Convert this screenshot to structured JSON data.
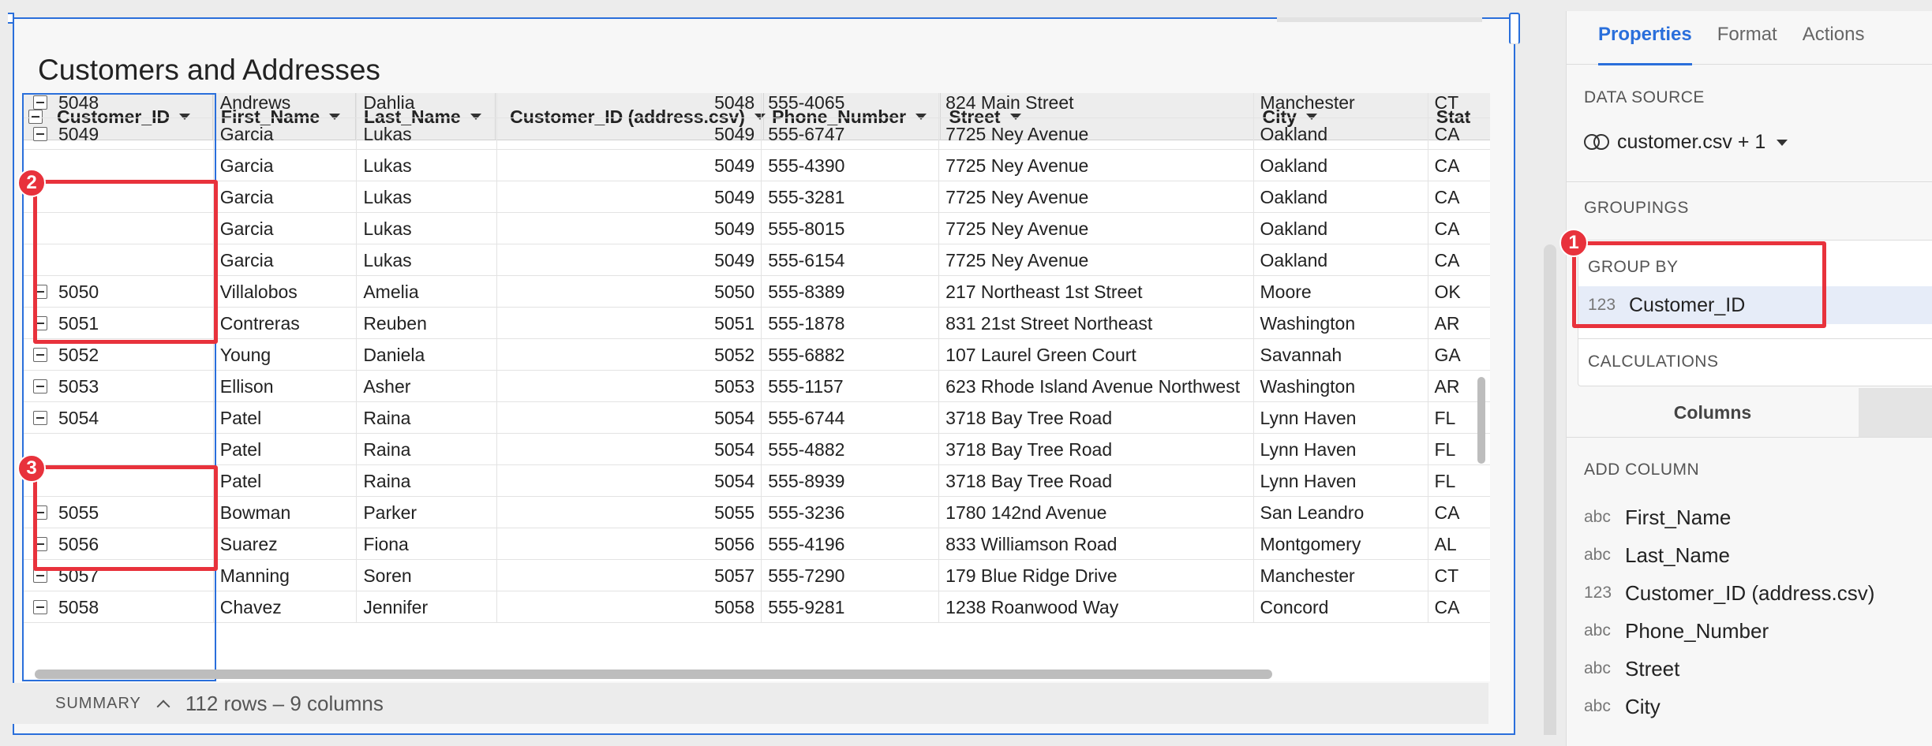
{
  "title": "Customers and Addresses",
  "table": {
    "columns": [
      "Customer_ID",
      "First_Name",
      "Last_Name",
      "Customer_ID (address.csv)",
      "Phone_Number",
      "Street",
      "City",
      "Stat"
    ],
    "rows": [
      {
        "id": "5048",
        "first": "Andrews",
        "last": "Dahlia",
        "cid": "5048",
        "phone": "555-4065",
        "street": "824 Main Street",
        "city": "Manchester",
        "state": "CT",
        "group": true
      },
      {
        "id": "5049",
        "first": "Garcia",
        "last": "Lukas",
        "cid": "5049",
        "phone": "555-6747",
        "street": "7725 Ney Avenue",
        "city": "Oakland",
        "state": "CA",
        "group": true
      },
      {
        "id": "",
        "first": "Garcia",
        "last": "Lukas",
        "cid": "5049",
        "phone": "555-4390",
        "street": "7725 Ney Avenue",
        "city": "Oakland",
        "state": "CA",
        "group": false
      },
      {
        "id": "",
        "first": "Garcia",
        "last": "Lukas",
        "cid": "5049",
        "phone": "555-3281",
        "street": "7725 Ney Avenue",
        "city": "Oakland",
        "state": "CA",
        "group": false
      },
      {
        "id": "",
        "first": "Garcia",
        "last": "Lukas",
        "cid": "5049",
        "phone": "555-8015",
        "street": "7725 Ney Avenue",
        "city": "Oakland",
        "state": "CA",
        "group": false
      },
      {
        "id": "",
        "first": "Garcia",
        "last": "Lukas",
        "cid": "5049",
        "phone": "555-6154",
        "street": "7725 Ney Avenue",
        "city": "Oakland",
        "state": "CA",
        "group": false
      },
      {
        "id": "5050",
        "first": "Villalobos",
        "last": "Amelia",
        "cid": "5050",
        "phone": "555-8389",
        "street": "217 Northeast 1st Street",
        "city": "Moore",
        "state": "OK",
        "group": true
      },
      {
        "id": "5051",
        "first": "Contreras",
        "last": "Reuben",
        "cid": "5051",
        "phone": "555-1878",
        "street": "831 21st Street Northeast",
        "city": "Washington",
        "state": "AR",
        "group": true
      },
      {
        "id": "5052",
        "first": "Young",
        "last": "Daniela",
        "cid": "5052",
        "phone": "555-6882",
        "street": "107 Laurel Green Court",
        "city": "Savannah",
        "state": "GA",
        "group": true
      },
      {
        "id": "5053",
        "first": "Ellison",
        "last": "Asher",
        "cid": "5053",
        "phone": "555-1157",
        "street": "623 Rhode Island Avenue Northwest",
        "city": "Washington",
        "state": "AR",
        "group": true
      },
      {
        "id": "5054",
        "first": "Patel",
        "last": "Raina",
        "cid": "5054",
        "phone": "555-6744",
        "street": "3718 Bay Tree Road",
        "city": "Lynn Haven",
        "state": "FL",
        "group": true
      },
      {
        "id": "",
        "first": "Patel",
        "last": "Raina",
        "cid": "5054",
        "phone": "555-4882",
        "street": "3718 Bay Tree Road",
        "city": "Lynn Haven",
        "state": "FL",
        "group": false
      },
      {
        "id": "",
        "first": "Patel",
        "last": "Raina",
        "cid": "5054",
        "phone": "555-8939",
        "street": "3718 Bay Tree Road",
        "city": "Lynn Haven",
        "state": "FL",
        "group": false
      },
      {
        "id": "5055",
        "first": "Bowman",
        "last": "Parker",
        "cid": "5055",
        "phone": "555-3236",
        "street": "1780 142nd Avenue",
        "city": "San Leandro",
        "state": "CA",
        "group": true
      },
      {
        "id": "5056",
        "first": "Suarez",
        "last": "Fiona",
        "cid": "5056",
        "phone": "555-4196",
        "street": "833 Williamson Road",
        "city": "Montgomery",
        "state": "AL",
        "group": true
      },
      {
        "id": "5057",
        "first": "Manning",
        "last": "Soren",
        "cid": "5057",
        "phone": "555-7290",
        "street": "179 Blue Ridge Drive",
        "city": "Manchester",
        "state": "CT",
        "group": true
      },
      {
        "id": "5058",
        "first": "Chavez",
        "last": "Jennifer",
        "cid": "5058",
        "phone": "555-9281",
        "street": "1238 Roanwood Way",
        "city": "Concord",
        "state": "CA",
        "group": true
      }
    ]
  },
  "summary": {
    "label": "SUMMARY",
    "count": "112 rows – 9 columns"
  },
  "annotations": {
    "one": "1",
    "two": "2",
    "three": "3"
  },
  "panel": {
    "tabs": [
      "Properties",
      "Format",
      "Actions"
    ],
    "data_source_label": "DATA SOURCE",
    "data_source_value": "customer.csv + 1",
    "groupings_label": "GROUPINGS",
    "group_by_label": "GROUP BY",
    "group_by_field": {
      "type": "123",
      "name": "Customer_ID"
    },
    "calculations_label": "CALCULATIONS",
    "columns_tab": "Columns",
    "add_column_label": "ADD COLUMN",
    "columns": [
      {
        "type": "abc",
        "name": "First_Name"
      },
      {
        "type": "abc",
        "name": "Last_Name"
      },
      {
        "type": "123",
        "name": "Customer_ID (address.csv)"
      },
      {
        "type": "abc",
        "name": "Phone_Number"
      },
      {
        "type": "abc",
        "name": "Street"
      },
      {
        "type": "abc",
        "name": "City"
      }
    ]
  },
  "colors": {
    "accent": "#2a6fdb",
    "highlight": "#e8323c"
  }
}
